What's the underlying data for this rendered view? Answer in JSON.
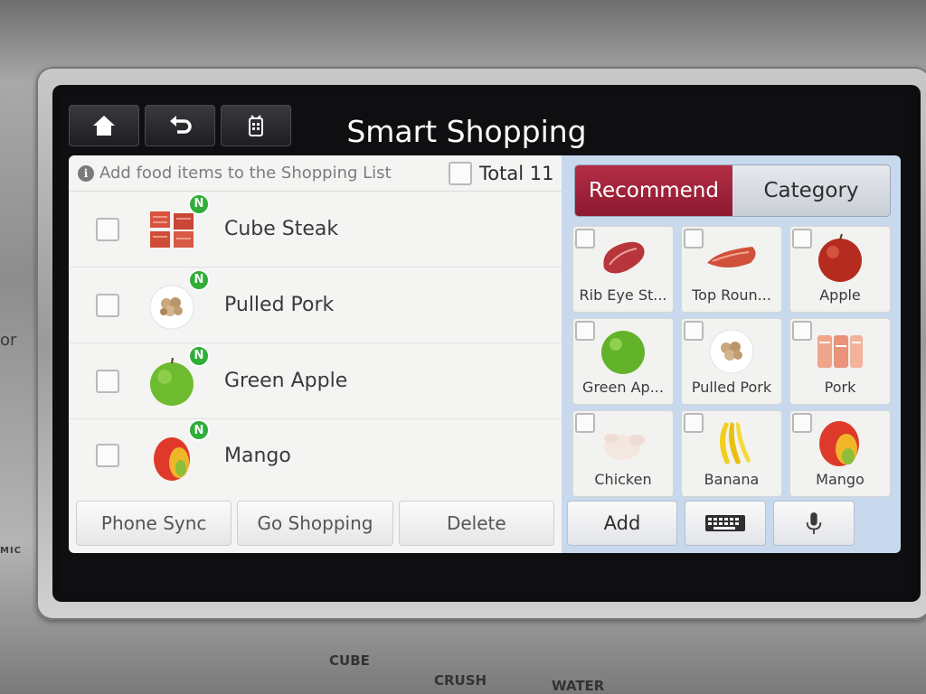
{
  "device": {
    "side_label": "or",
    "mic_label": "MIC",
    "dispenser_labels": [
      "CUBE",
      "CRUSH",
      "WATER"
    ]
  },
  "header": {
    "title": "Smart Shopping",
    "buttons": [
      {
        "icon": "home-icon"
      },
      {
        "icon": "back-icon"
      },
      {
        "icon": "fridge-icon"
      }
    ]
  },
  "shopping_list": {
    "info_text": "Add food items to the Shopping List",
    "total_label": "Total 11",
    "new_badge": "N",
    "items": [
      {
        "name": "Cube Steak",
        "icon": "cube-steak-icon",
        "is_new": true,
        "checked": false
      },
      {
        "name": "Pulled Pork",
        "icon": "pulled-pork-icon",
        "is_new": true,
        "checked": false
      },
      {
        "name": "Green Apple",
        "icon": "green-apple-icon",
        "is_new": true,
        "checked": false
      },
      {
        "name": "Mango",
        "icon": "mango-icon",
        "is_new": true,
        "checked": false
      }
    ],
    "footer": {
      "phone_sync": "Phone Sync",
      "go_shopping": "Go Shopping",
      "delete": "Delete"
    }
  },
  "recommend_panel": {
    "tabs": {
      "recommend": "Recommend",
      "category": "Category",
      "active": "recommend"
    },
    "tiles": [
      {
        "label": "Rib Eye St...",
        "icon": "rib-eye-icon"
      },
      {
        "label": "Top Roun...",
        "icon": "top-round-icon"
      },
      {
        "label": "Apple",
        "icon": "apple-icon"
      },
      {
        "label": "Green Ap...",
        "icon": "green-apple-icon"
      },
      {
        "label": "Pulled Pork",
        "icon": "pulled-pork-icon"
      },
      {
        "label": "Pork",
        "icon": "pork-icon"
      },
      {
        "label": "Chicken",
        "icon": "chicken-icon"
      },
      {
        "label": "Banana",
        "icon": "banana-icon"
      },
      {
        "label": "Mango",
        "icon": "mango-icon"
      }
    ],
    "footer": {
      "add": "Add",
      "keyboard_icon": "keyboard-icon",
      "mic_icon": "microphone-icon"
    }
  },
  "colors": {
    "active_tab": "#a0243c",
    "new_badge": "#2fae3a",
    "panel_bg": "#c8d9ee",
    "list_bg": "#f4f4f2"
  }
}
